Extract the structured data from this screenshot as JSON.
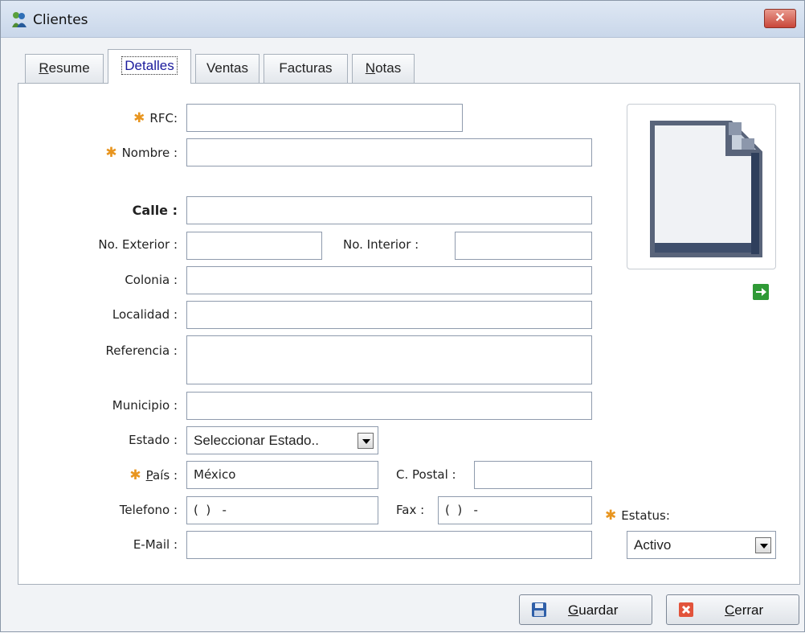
{
  "window": {
    "title": "Clientes",
    "close_label": "✕"
  },
  "tabs": [
    {
      "label": "Resume",
      "underline": "R",
      "rest": "esume",
      "active": false
    },
    {
      "label": "Detalles",
      "active": true
    },
    {
      "label": "Ventas",
      "active": false
    },
    {
      "label": "Facturas",
      "active": false
    },
    {
      "label": "Notas",
      "underline": "N",
      "rest": "otas",
      "active": false
    }
  ],
  "form": {
    "required_mark": "✱",
    "rfc": {
      "label": "RFC:",
      "value": ""
    },
    "nombre": {
      "label": "Nombre :",
      "value": ""
    },
    "calle": {
      "label": "Calle :",
      "value": ""
    },
    "no_exterior": {
      "label": "No. Exterior :",
      "value": ""
    },
    "no_interior": {
      "label": "No. Interior :",
      "value": ""
    },
    "colonia": {
      "label": "Colonia :",
      "value": ""
    },
    "localidad": {
      "label": "Localidad :",
      "value": ""
    },
    "referencia": {
      "label": "Referencia :",
      "value": ""
    },
    "municipio": {
      "label": "Municipio :",
      "value": ""
    },
    "estado": {
      "label": "Estado :",
      "value": "Seleccionar Estado.."
    },
    "pais": {
      "label_underline": "P",
      "label_rest": "aís :",
      "value": "México"
    },
    "cpostal": {
      "label": "C. Postal :",
      "value": ""
    },
    "telefono": {
      "label": "Telefono :",
      "value": "(  )   -"
    },
    "fax": {
      "label": "Fax :",
      "value": "(  )   -"
    },
    "email": {
      "label": "E-Mail :",
      "value": ""
    },
    "estatus": {
      "label": "Estatus:",
      "value": "Activo"
    }
  },
  "buttons": {
    "guardar": {
      "underline": "G",
      "rest": "uardar"
    },
    "cerrar": {
      "underline": "C",
      "rest": "errar"
    }
  },
  "icons": {
    "app": "clients-icon",
    "image_placeholder": "blank-document-icon",
    "next": "green-arrow-right-icon",
    "save": "floppy-disk-icon",
    "close": "red-x-icon"
  }
}
